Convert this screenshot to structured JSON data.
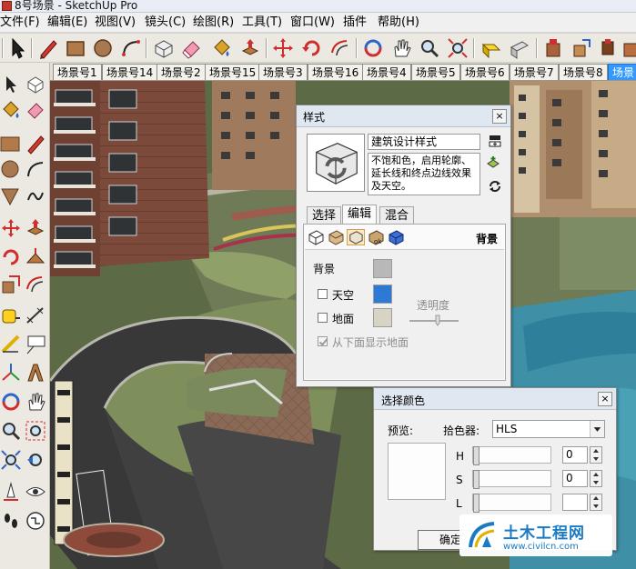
{
  "window": {
    "title": "8号场景 - SketchUp Pro"
  },
  "menu": [
    "文件(F)",
    "编辑(E)",
    "视图(V)",
    "镜头(C)",
    "绘图(R)",
    "工具(T)",
    "窗口(W)",
    "插件",
    "帮助(H)"
  ],
  "toolbar": {
    "icons": [
      "select-icon",
      "pencil-icon",
      "rectangle-icon",
      "circle-icon",
      "arc-icon",
      "make-component-icon",
      "eraser-icon",
      "paint-bucket-icon",
      "push-pull-icon",
      "move-icon",
      "rotate-icon",
      "offset-icon",
      "orbit-icon",
      "pan-icon",
      "zoom-icon",
      "zoom-extents-icon",
      "previous-view-icon",
      "next-view-icon",
      "warehouse-icon",
      "share-model-icon",
      "component-search-icon",
      "extension-icon"
    ]
  },
  "scene_tabs": {
    "items": [
      "场景号1",
      "场景号14",
      "场景号2",
      "场景号15",
      "场景号3",
      "场景号16",
      "场景号4",
      "场景号5",
      "场景号6",
      "场景号7",
      "场景号8",
      "场景"
    ],
    "active": 11
  },
  "left_tools": {
    "icons": [
      "select-icon",
      "component-icon",
      "paint-bucket-icon",
      "eraser-icon",
      "rectangle-icon",
      "line-icon",
      "circle-icon",
      "arc-icon",
      "polygon-icon",
      "freehand-icon",
      "move-icon",
      "push-pull-icon",
      "rotate-icon",
      "follow-me-icon",
      "scale-icon",
      "offset-icon",
      "tape-measure-icon",
      "dimension-icon",
      "protractor-icon",
      "text-icon",
      "axes-icon",
      "3d-text-icon",
      "orbit-icon",
      "pan-icon",
      "zoom-icon",
      "zoom-window-icon",
      "zoom-extents-icon",
      "previous-icon",
      "position-camera-icon",
      "look-around-icon",
      "walk-icon",
      "section-plane-icon"
    ]
  },
  "styles_dialog": {
    "title": "样式",
    "style_name": "建筑设计样式",
    "style_description": "不饱和色，启用轮廓、延长线和终点边线效果及天空。",
    "tabs": [
      "选择",
      "编辑",
      "混合"
    ],
    "active_tab": 1,
    "section_title": "背景",
    "rows": {
      "background": {
        "label": "背景",
        "color": "#b8b8b8"
      },
      "sky": {
        "label": "天空",
        "checked": false,
        "color": "#2c79d6"
      },
      "ground": {
        "label": "地面",
        "checked": false,
        "color": "#d8d4c4"
      },
      "transparency": {
        "label": "透明度"
      },
      "show_ground_from_below": {
        "label": "从下面显示地面",
        "checked": true
      }
    }
  },
  "color_dialog": {
    "title": "选择颜色",
    "preview_label": "预览:",
    "picker_label": "拾色器:",
    "picker_value": "HLS",
    "fields": [
      {
        "label": "H",
        "value": "0"
      },
      {
        "label": "S",
        "value": "0"
      },
      {
        "label": "L",
        "value": ""
      }
    ],
    "ok_label": "确定"
  },
  "watermark": {
    "title": "土木工程网",
    "url": "www.civilcn.com"
  },
  "colors": {
    "accent": "#3399ff",
    "watermark": "#1a7ac3"
  }
}
